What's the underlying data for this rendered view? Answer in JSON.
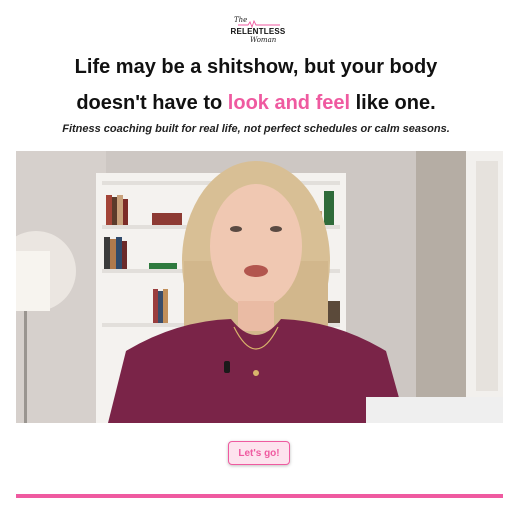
{
  "logo": {
    "the": "The",
    "brand": "RELENTLESS",
    "women": "Woman"
  },
  "headline": {
    "line1": "Life may be a shitshow, but your body",
    "line2_start": "doesn't have to ",
    "line2_accent": "look and feel",
    "line2_end": " like one."
  },
  "subheadline": "Fitness coaching built for real life, not perfect schedules or calm seasons.",
  "video": {
    "play_icon": "play-icon"
  },
  "cta": {
    "label": "Let's go!"
  },
  "colors": {
    "accent": "#ef5aa0",
    "button_bg": "#fde3ee",
    "text": "#111111"
  }
}
